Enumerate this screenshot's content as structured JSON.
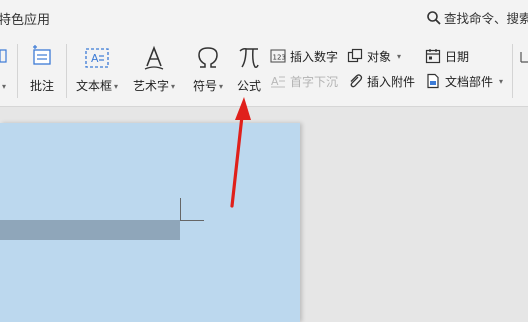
{
  "titlebar": {
    "app_tab_label": "特色应用",
    "search_label": "查找命令、搜索"
  },
  "ribbon": {
    "comment_label": "批注",
    "textbox_label": "文本框",
    "wordart_label": "艺术字",
    "symbol_label": "符号",
    "formula_label": "公式",
    "insert_number_label": "插入数字",
    "dropcap_label": "首字下沉",
    "object_label": "对象",
    "insert_attachment_label": "插入附件",
    "date_label": "日期",
    "doc_parts_label": "文档部件"
  },
  "colors": {
    "page_bg": "#bcd8ee",
    "selection_bar": "#8fa6ba",
    "annotation_arrow": "#e0201b"
  },
  "icons": [
    "search-icon",
    "comment-icon",
    "textbox-icon",
    "wordart-icon",
    "omega-icon",
    "pi-icon",
    "number-icon",
    "dropcap-icon",
    "object-icon",
    "paperclip-icon",
    "calendar-icon",
    "docparts-icon"
  ]
}
